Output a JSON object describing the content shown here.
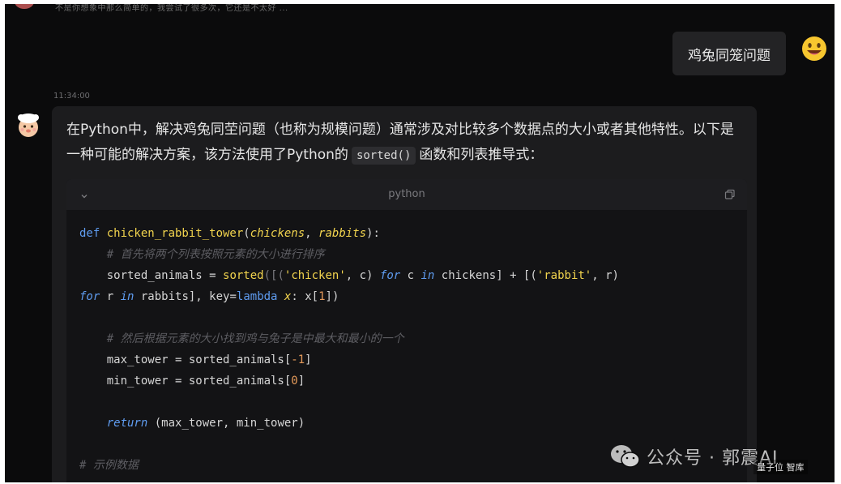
{
  "top": {
    "faded_text": "不是你想象中那么简单的，我尝试了很多次，它还是不太好 ..."
  },
  "user_message": {
    "text": "鸡兔同笼问题"
  },
  "timestamp": "11:34:00",
  "assistant_message": {
    "text_before": "在Python中，解决鸡兔同茔问题（也称为规模问题）通常涉及对比较多个数据点的大小或者其他特性。以下是一种可能的解决方案，该方法使用了Python的",
    "inline_code": "sorted()",
    "text_after": "函数和列表推导式："
  },
  "code_block": {
    "language": "python",
    "lines": [
      {
        "segments": [
          {
            "t": "def ",
            "c": "kw"
          },
          {
            "t": "chicken_rabbit_tower",
            "c": "fn"
          },
          {
            "t": "(",
            "c": ""
          },
          {
            "t": "chickens",
            "c": "param"
          },
          {
            "t": ", ",
            "c": ""
          },
          {
            "t": "rabbits",
            "c": "param"
          },
          {
            "t": "):",
            "c": ""
          }
        ]
      },
      {
        "segments": [
          {
            "t": "    # 首先将两个列表按照元素的大小进行排序",
            "c": "cmt"
          }
        ]
      },
      {
        "segments": [
          {
            "t": "    sorted_animals = ",
            "c": ""
          },
          {
            "t": "sorted",
            "c": "fn"
          },
          {
            "t": "([(",
            "c": "dim"
          },
          {
            "t": "'chicken'",
            "c": "str"
          },
          {
            "t": ", c) ",
            "c": ""
          },
          {
            "t": "for",
            "c": "ital-kw"
          },
          {
            "t": " c ",
            "c": ""
          },
          {
            "t": "in",
            "c": "ital-kw"
          },
          {
            "t": " chickens] + [(",
            "c": ""
          },
          {
            "t": "'rabbit'",
            "c": "str"
          },
          {
            "t": ", r)",
            "c": ""
          }
        ]
      },
      {
        "segments": [
          {
            "t": "for",
            "c": "ital-kw"
          },
          {
            "t": " r ",
            "c": ""
          },
          {
            "t": "in",
            "c": "ital-kw"
          },
          {
            "t": " rabbits], ",
            "c": ""
          },
          {
            "t": "key",
            "c": ""
          },
          {
            "t": "=",
            "c": ""
          },
          {
            "t": "lambda",
            "c": "kw"
          },
          {
            "t": " ",
            "c": ""
          },
          {
            "t": "x",
            "c": "param"
          },
          {
            "t": ": x[",
            "c": ""
          },
          {
            "t": "1",
            "c": "num"
          },
          {
            "t": "])",
            "c": ""
          }
        ]
      },
      {
        "segments": [
          {
            "t": "",
            "c": ""
          }
        ]
      },
      {
        "segments": [
          {
            "t": "    # 然后根据元素的大小找到鸡与兔子是中最大和最小的一个",
            "c": "cmt"
          }
        ]
      },
      {
        "segments": [
          {
            "t": "    max_tower = sorted_animals[",
            "c": ""
          },
          {
            "t": "-1",
            "c": "num"
          },
          {
            "t": "]",
            "c": ""
          }
        ]
      },
      {
        "segments": [
          {
            "t": "    min_tower = sorted_animals[",
            "c": ""
          },
          {
            "t": "0",
            "c": "num"
          },
          {
            "t": "]",
            "c": ""
          }
        ]
      },
      {
        "segments": [
          {
            "t": "",
            "c": ""
          }
        ]
      },
      {
        "segments": [
          {
            "t": "    ",
            "c": ""
          },
          {
            "t": "return",
            "c": "ital-kw"
          },
          {
            "t": " (max_tower, min_tower)",
            "c": ""
          }
        ]
      },
      {
        "segments": [
          {
            "t": "",
            "c": ""
          }
        ]
      },
      {
        "segments": [
          {
            "t": "# 示例数据",
            "c": "cmt"
          }
        ]
      }
    ]
  },
  "watermark": {
    "main": "公众号 · 郭震AI",
    "sub": "量子位 智库"
  },
  "icons": {
    "user_avatar": "grinning-face-icon",
    "bot_avatar": "chef-bot-icon",
    "collapse": "chevron-down-icon",
    "copy": "copy-icon",
    "wechat": "wechat-icon"
  },
  "colors": {
    "background": "#0b0b0c",
    "bubble": "#1c1c1e",
    "code_bg": "#131315",
    "keyword": "#5f9cf0",
    "function": "#f2d44e",
    "comment": "#5d5d62"
  }
}
